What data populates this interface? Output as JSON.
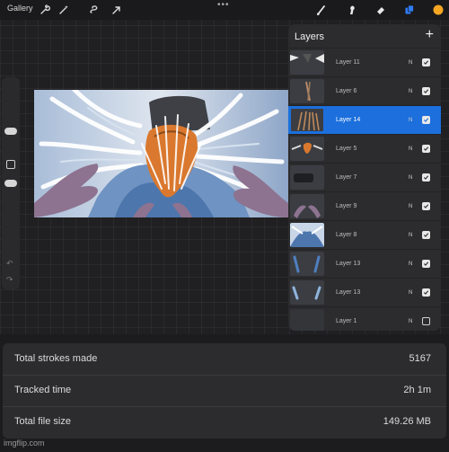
{
  "toolbar": {
    "gallery_label": "Gallery",
    "more_dots": "•••",
    "left_tools": [
      "wrench-icon",
      "magic-wand-icon",
      "selection-icon",
      "transform-icon"
    ],
    "right_tools": [
      "brush-icon",
      "smudge-icon",
      "eraser-icon",
      "layers-icon",
      "color-icon"
    ],
    "color_swatch": "#f5a623",
    "layers_icon_color": "#2f7bf5"
  },
  "layers_panel": {
    "title": "Layers",
    "add_icon": "+",
    "layers": [
      {
        "name": "Layer 11",
        "blend": "N",
        "visible": true,
        "active": false
      },
      {
        "name": "Layer 6",
        "blend": "N",
        "visible": true,
        "active": false
      },
      {
        "name": "Layer 14",
        "blend": "N",
        "visible": true,
        "active": true
      },
      {
        "name": "Layer 5",
        "blend": "N",
        "visible": true,
        "active": false
      },
      {
        "name": "Layer 7",
        "blend": "N",
        "visible": true,
        "active": false
      },
      {
        "name": "Layer 9",
        "blend": "N",
        "visible": true,
        "active": false
      },
      {
        "name": "Layer 8",
        "blend": "N",
        "visible": true,
        "active": false
      },
      {
        "name": "Layer 13",
        "blend": "N",
        "visible": true,
        "active": false
      },
      {
        "name": "Layer 13",
        "blend": "N",
        "visible": true,
        "active": false
      },
      {
        "name": "Layer 1",
        "blend": "N",
        "visible": false,
        "active": false
      }
    ],
    "active_color": "#1c6fdc"
  },
  "stats": {
    "strokes_label": "Total strokes made",
    "strokes_value": "5167",
    "time_label": "Tracked time",
    "time_value": "2h 1m",
    "size_label": "Total file size",
    "size_value": "149.26 MB"
  },
  "watermark": "imgflip.com"
}
